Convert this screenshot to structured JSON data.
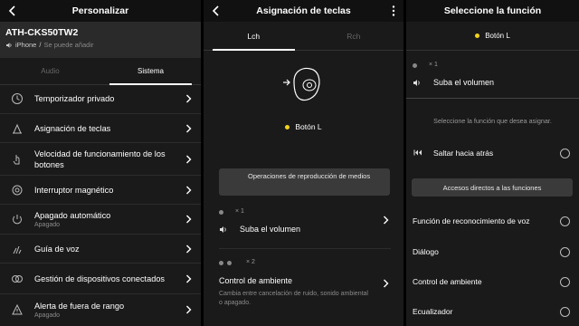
{
  "panel1": {
    "title": "Personalizar",
    "device": {
      "name": "ATH-CKS50TW2",
      "source": "iPhone",
      "sep": "/",
      "note": "Se puede añadir"
    },
    "tabs": [
      "Audio",
      "Sistema"
    ],
    "items": [
      {
        "label": "Temporizador privado",
        "icon": "timer-icon"
      },
      {
        "label": "Asignación de teclas",
        "icon": "key-assign-icon"
      },
      {
        "label": "Velocidad de funcionamiento de los botones",
        "icon": "touch-speed-icon"
      },
      {
        "label": "Interruptor magnético",
        "icon": "magnet-icon"
      },
      {
        "label": "Apagado automático",
        "sub": "Apagado",
        "icon": "power-icon"
      },
      {
        "label": "Guía de voz",
        "icon": "voice-guide-icon"
      },
      {
        "label": "Gestión de dispositivos conectados",
        "icon": "devices-icon"
      },
      {
        "label": "Alerta de fuera de rango",
        "sub": "Apagado",
        "icon": "range-alert-icon"
      }
    ]
  },
  "panel2": {
    "title": "Asignación de teclas",
    "tabs": [
      "Lch",
      "Rch"
    ],
    "button_label": "Botón L",
    "section_header": "Operaciones de reproducción de medios",
    "single_tap": {
      "count": "× 1",
      "action": "Suba el volumen"
    },
    "double_tap": {
      "count": "× 2",
      "action": "Control de ambiente",
      "desc": "Cambia entre cancelación de ruido, sonido ambiental o apagado."
    }
  },
  "panel3": {
    "title": "Seleccione la función",
    "button_label": "Botón L",
    "current": {
      "count": "× 1",
      "action": "Suba el volumen"
    },
    "prompt": "Seleccione la función que desea asignar.",
    "option_skip": "Saltar hacia atrás",
    "shortcut_header": "Accesos directos a las funciones",
    "options": [
      "Función de reconocimiento de voz",
      "Diálogo",
      "Control de ambiente",
      "Ecualizador"
    ]
  },
  "colors": {
    "accent_yellow": "#f2d319",
    "bg": "#1a1a1a",
    "header_bg": "#111111"
  }
}
